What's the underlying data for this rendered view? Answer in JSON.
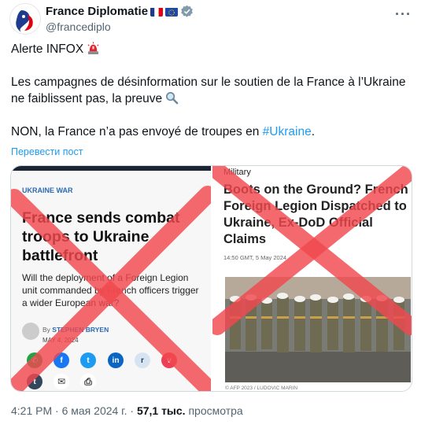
{
  "account": {
    "name": "France Diplomatie",
    "handle": "@francediplo"
  },
  "tweet": {
    "line1": "Alerte INFOX",
    "line2": "Les campagnes de désinformation sur le soutien de la France à l’Ukraine ne faiblissent pas, la preuve",
    "line3_prefix": "NON, la France n’a pas envoyé de troupes en ",
    "line3_hashtag": "#Ukraine",
    "line3_suffix": ".",
    "translate": "Перевести пост"
  },
  "left_article": {
    "kicker": "UKRAINE WAR",
    "title": "France sends combat troops to Ukraine battlefront",
    "subtitle": "Will the deployment of a Foreign Legion unit commanded by French officers trigger a wider European war?",
    "author_prefix": "By ",
    "author": "STEPHEN BRYEN",
    "date": "MAY 4, 2024",
    "share_icons": [
      "whatsapp-icon",
      "facebook-icon",
      "twitter-icon",
      "linkedin-icon",
      "reddit-icon",
      "pocket-icon",
      "tumblr-icon",
      "email-icon",
      "print-icon"
    ]
  },
  "right_article": {
    "section": "Military",
    "title": "Boots on the Ground? French Foreign Legion Dispatched to Ukraine, Ex-DoD Official Claims",
    "meta": "14:50 GMT, 5 May 2024",
    "credit": "© AFP 2023 / LUDOVIC MARIN"
  },
  "footer": {
    "time": "4:21 PM",
    "dot1": " · ",
    "date": "6 мая 2024 г.",
    "dot2": " · ",
    "views": "57,1 тыс.",
    "views_label": " просмотра"
  },
  "colors": {
    "accent": "#1d9bf0",
    "cross": "#f0484e",
    "kicker": "#2a6ab3"
  }
}
